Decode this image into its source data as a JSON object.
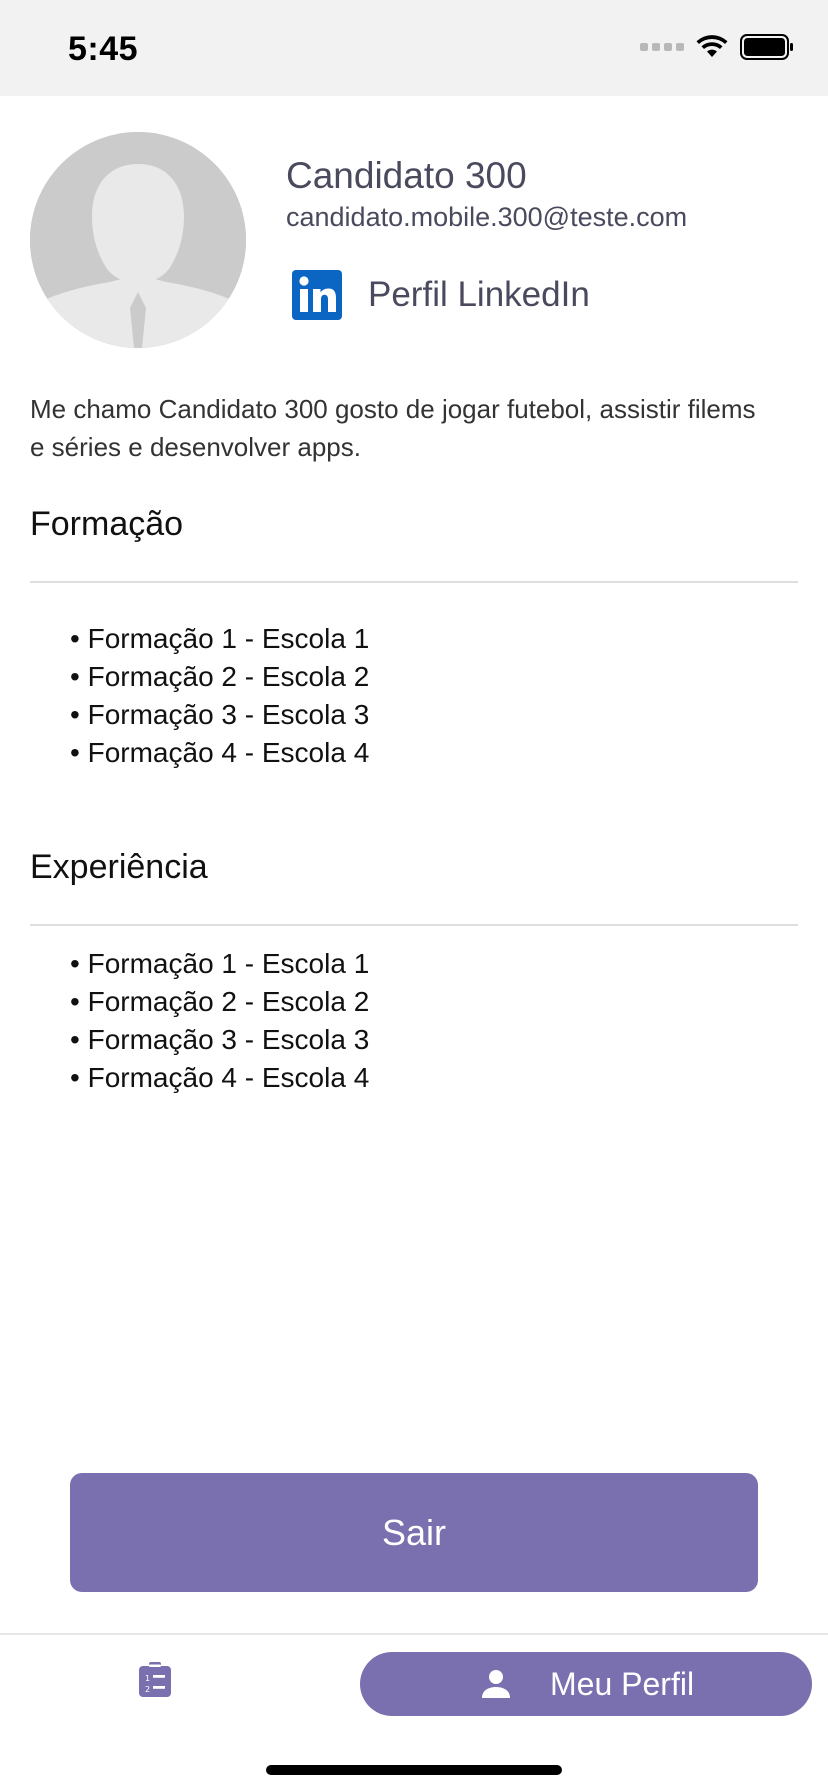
{
  "status_bar": {
    "time": "5:45"
  },
  "profile": {
    "name": "Candidato 300",
    "email": "candidato.mobile.300@teste.com",
    "linkedin_label": "Perfil LinkedIn",
    "bio": "Me chamo Candidato 300 gosto de jogar futebol, assistir filems e séries e desenvolver apps."
  },
  "formacao": {
    "title": "Formação",
    "items": [
      "Formação 1 - Escola 1",
      "Formação 2 - Escola 2",
      "Formação 3 - Escola 3",
      "Formação 4 - Escola 4"
    ]
  },
  "experiencia": {
    "title": "Experiência",
    "items": [
      "Formação 1 - Escola 1",
      "Formação 2 - Escola 2",
      "Formação 3 - Escola 3",
      "Formação 4 - Escola 4"
    ]
  },
  "actions": {
    "logout_label": "Sair"
  },
  "tab_bar": {
    "list_icon": "clipboard-list-icon",
    "profile_icon": "person-icon",
    "profile_label": "Meu Perfil"
  },
  "colors": {
    "accent": "#7a70b0",
    "linkedin": "#0a66c2",
    "text_secondary": "#4a4a5e"
  }
}
